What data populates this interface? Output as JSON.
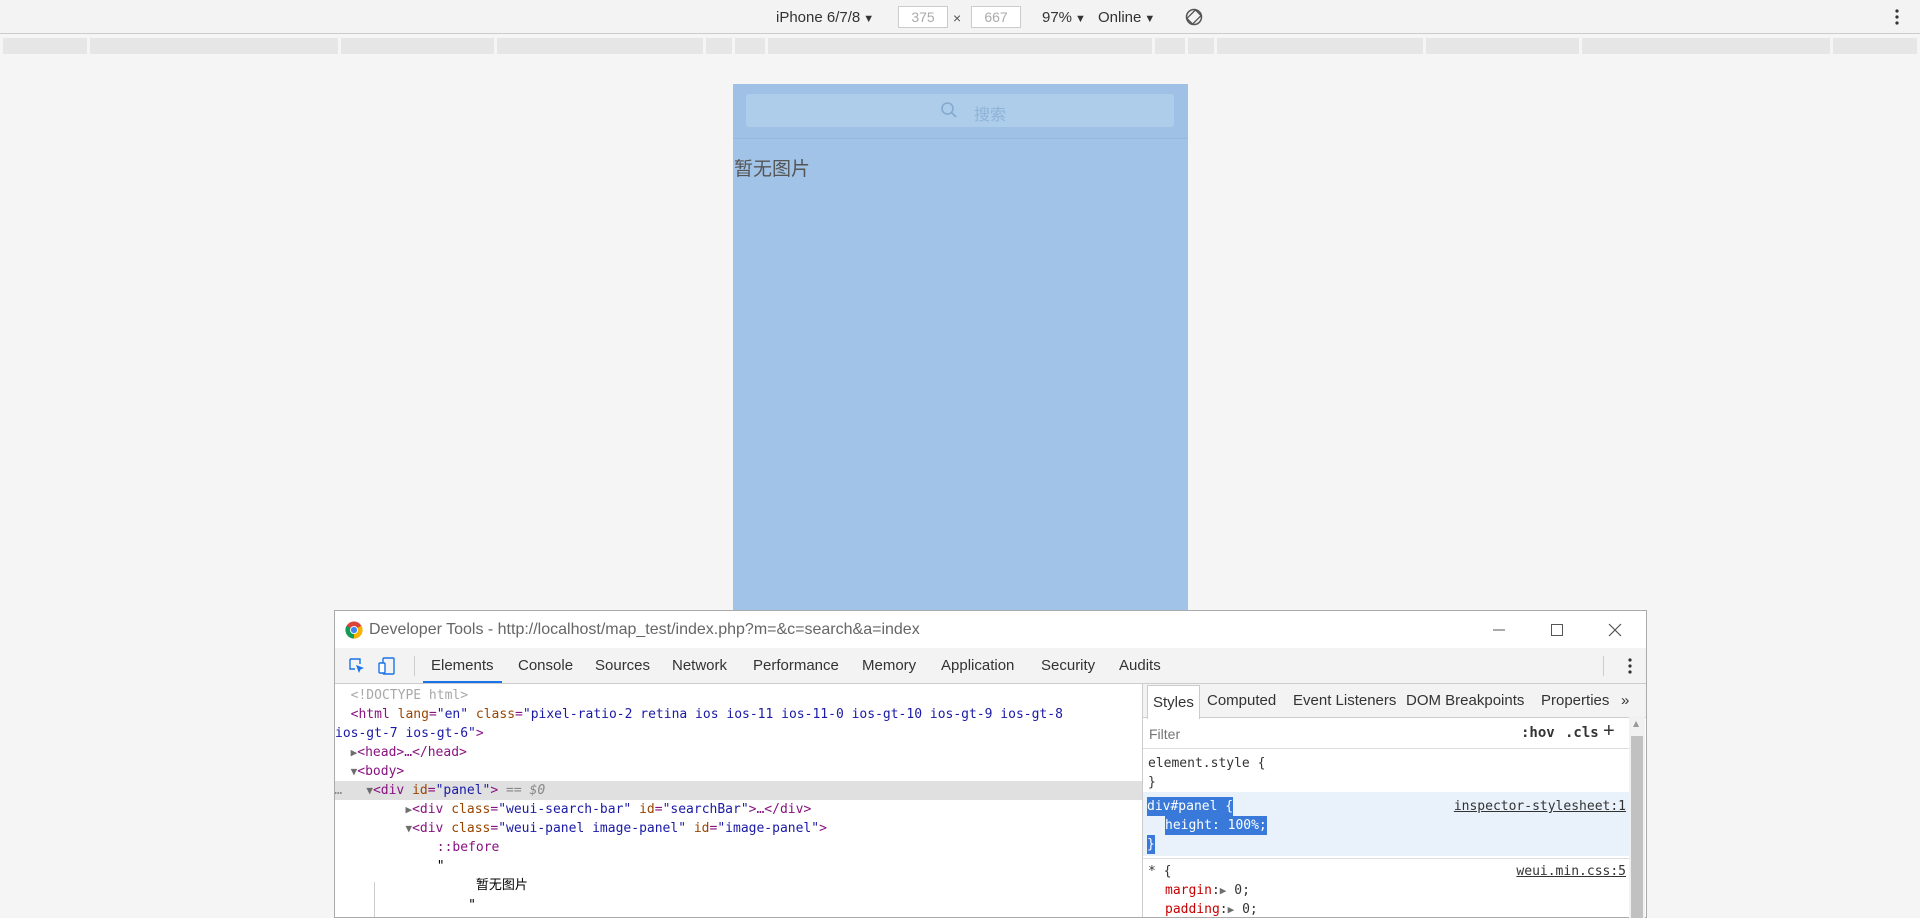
{
  "device_toolbar": {
    "device": "iPhone 6/7/8",
    "width": "375",
    "height": "667",
    "times": "×",
    "zoom": "97%",
    "network": "Online",
    "dropdown_glyph": "▼"
  },
  "viewport": {
    "search_placeholder": "搜索",
    "no_image_text": "暂无图片"
  },
  "devtools": {
    "title": "Developer Tools - http://localhost/map_test/index.php?m=&c=search&a=index",
    "tabs": [
      "Elements",
      "Console",
      "Sources",
      "Network",
      "Performance",
      "Memory",
      "Application",
      "Security",
      "Audits"
    ],
    "active_tab": "Elements",
    "elements": {
      "doctype": "<!DOCTYPE html>",
      "html_open_tag": "<html",
      "html_lang_attr": "lang",
      "html_lang_val": "\"en\"",
      "html_class_attr": "class",
      "html_class_val_1": "\"pixel-ratio-2 retina ios ios-11 ios-11-0 ios-gt-10 ios-gt-9 ios-gt-8",
      "html_class_val_2": "ios-gt-7 ios-gt-6\"",
      "head": "<head>…</head>",
      "body": "<body>",
      "panel_open": "<div",
      "id_attr": "id",
      "panel_id": "\"panel\"",
      "eq": "== $0",
      "ellipsis": "…",
      "search_open": "<div",
      "class_attr": "class",
      "search_class": "\"weui-search-bar\"",
      "search_id": "\"searchBar\"",
      "search_close": ">…</div>",
      "image_panel_open": "<div",
      "image_panel_class": "\"weui-panel image-panel\"",
      "image_panel_id": "\"image-panel\"",
      "before": "::before",
      "quote": "\"",
      "text_node": "暂无图片"
    },
    "styles": {
      "tabs": [
        "Styles",
        "Computed",
        "Event Listeners",
        "DOM Breakpoints",
        "Properties"
      ],
      "more": "»",
      "filter_placeholder": "Filter",
      "hov": ":hov",
      "cls": ".cls",
      "plus": "+",
      "element_style": "element.style {",
      "close_brace": "}",
      "rule_selector": "div#panel {",
      "rule_prop": "height: 100%;",
      "rule_source": "inspector-stylesheet:1",
      "universal_selector": "* {",
      "universal_source": "weui.min.css:5",
      "margin_prop": "margin",
      "margin_val": "0;",
      "padding_prop": "padding",
      "padding_val": "0;"
    }
  },
  "colors": {
    "viewport_bg": "#a1c3e7",
    "tab_accent": "#1a73e8",
    "selection": "#3879d9"
  }
}
